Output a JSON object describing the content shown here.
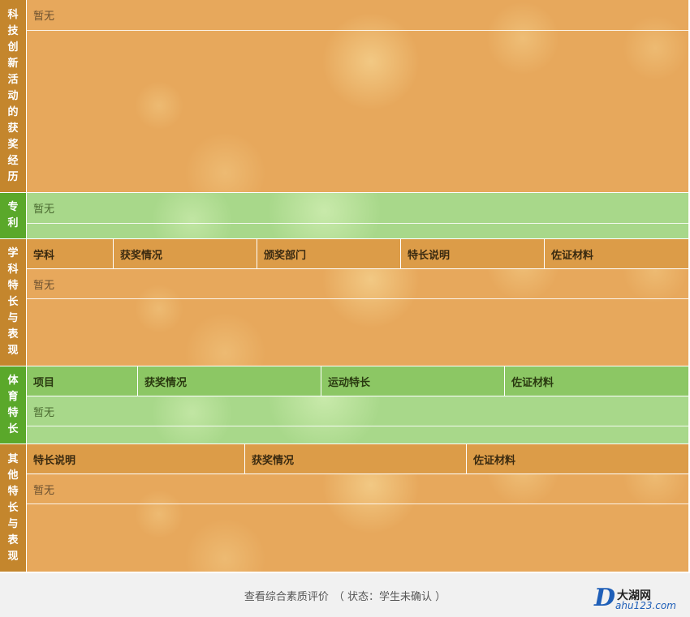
{
  "sections": {
    "tech": {
      "side_label": "科技创新活动的获奖经历",
      "empty_text": "暂无"
    },
    "patent": {
      "side_label": "专利",
      "empty_text": "暂无"
    },
    "academic": {
      "side_label": "学科特长与表现",
      "headers": [
        "学科",
        "获奖情况",
        "颁奖部门",
        "特长说明",
        "佐证材料"
      ],
      "empty_text": "暂无"
    },
    "sports": {
      "side_label": "体育特长",
      "headers": [
        "项目",
        "获奖情况",
        "运动特长",
        "佐证材料"
      ],
      "empty_text": "暂无"
    },
    "other": {
      "side_label": "其他特长与表现",
      "headers": [
        "特长说明",
        "获奖情况",
        "佐证材料"
      ],
      "empty_text": "暂无"
    }
  },
  "footer": {
    "link_text": "查看综合素质评价",
    "status_text": "（ 状态：学生未确认 ）"
  },
  "watermark": {
    "letter": "D",
    "name": "大湖网",
    "domain": "ahu123.com"
  }
}
